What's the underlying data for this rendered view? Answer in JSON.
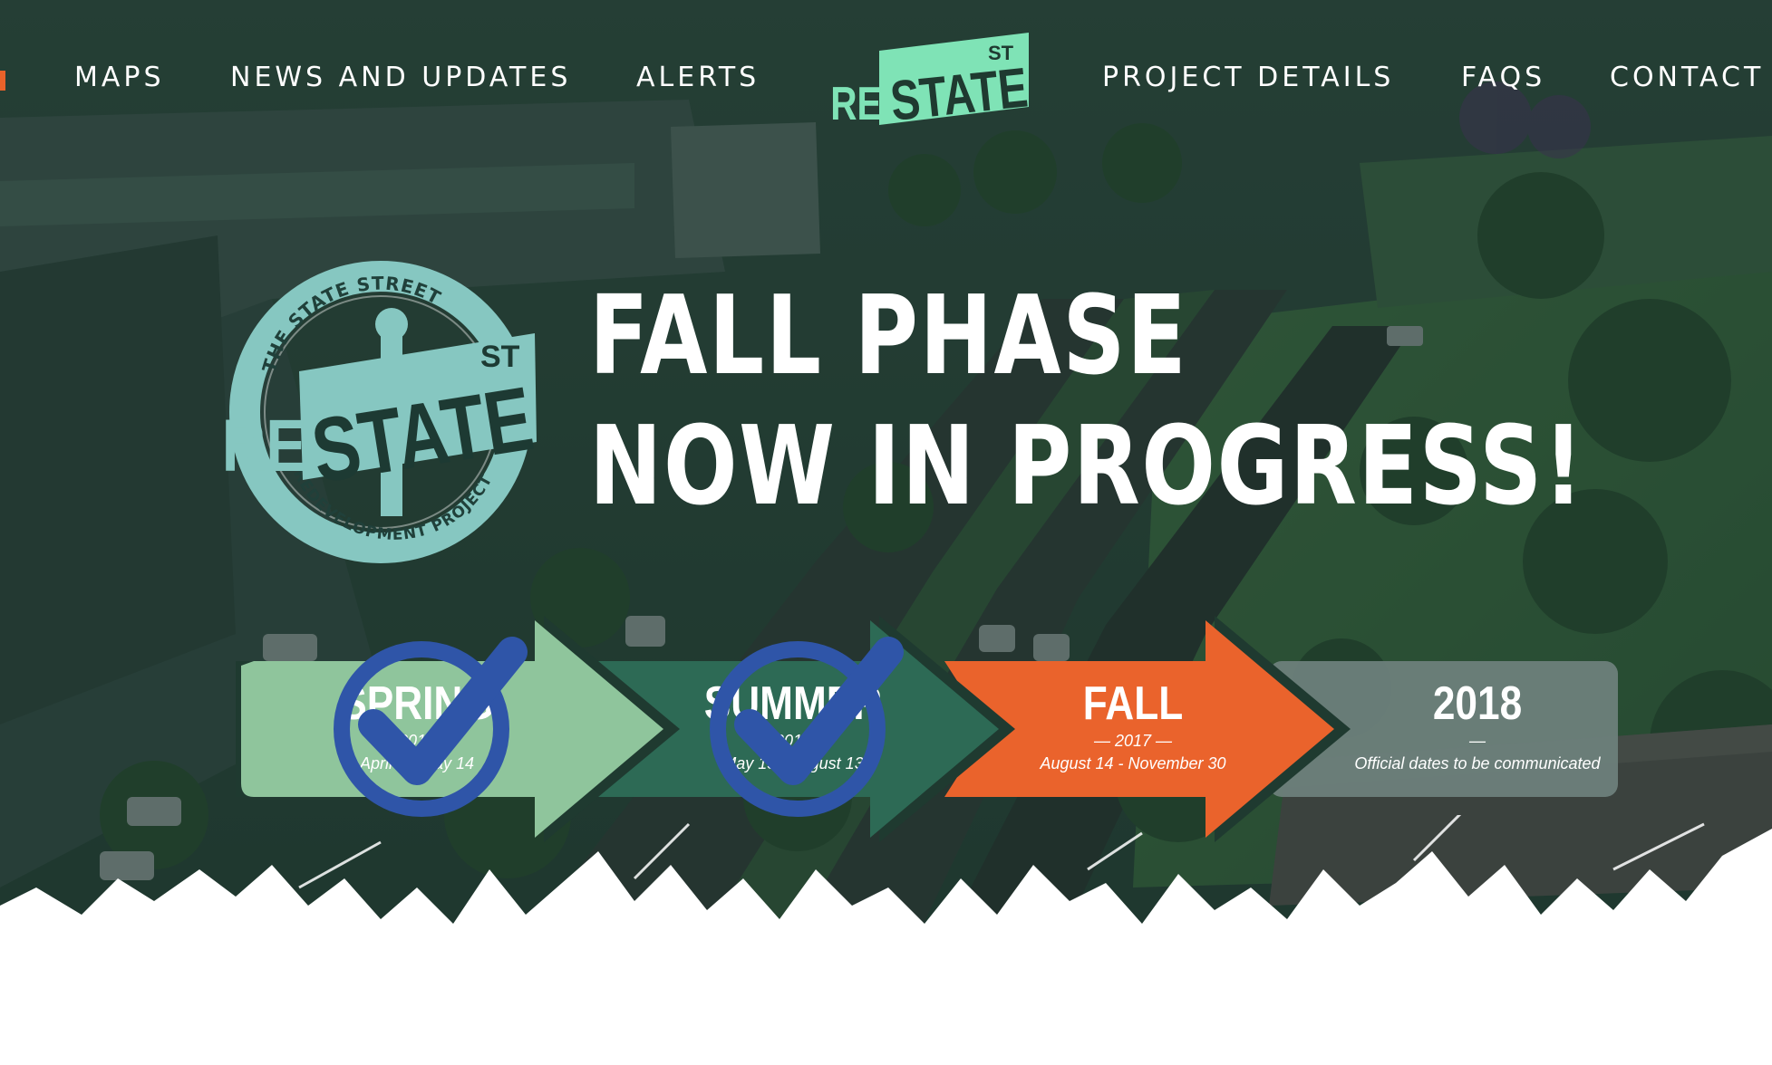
{
  "nav": {
    "items_left": [
      {
        "label": "MAPS"
      },
      {
        "label": "NEWS AND UPDATES"
      },
      {
        "label": "ALERTS"
      }
    ],
    "items_right": [
      {
        "label": "PROJECT DETAILS"
      },
      {
        "label": "FAQS"
      },
      {
        "label": "CONTACT"
      }
    ]
  },
  "logo_header": {
    "re": "RE",
    "state": "STATE",
    "st": "ST"
  },
  "badge": {
    "top_arc": "THE STATE STREET",
    "bottom_arc": "REDEVELOPMENT PROJECT",
    "re": "RE",
    "state": "STATE",
    "st": "ST"
  },
  "headline": {
    "line1": "FALL PHASE",
    "line2": "NOW IN PROGRESS!"
  },
  "timeline": {
    "phases": [
      {
        "name": "SPRING",
        "year": "2017",
        "dates": "April 1 - May 14",
        "status": "complete",
        "color": "#8fc59c"
      },
      {
        "name": "SUMMER",
        "year": "2017",
        "dates": "May 15 - August 13",
        "status": "complete",
        "color": "#2d6a55"
      },
      {
        "name": "FALL",
        "year": "2017",
        "dates": "August 14 - November 30",
        "status": "in-progress",
        "color": "#ea632c"
      },
      {
        "name": "2018",
        "year": "",
        "dates": "Official dates to be communicated",
        "status": "upcoming",
        "color": "#6d7f7b"
      }
    ],
    "check_color": "#2f55a8"
  },
  "colors": {
    "accent_mint": "#7fe3b6",
    "badge_teal": "#86c7c1",
    "overlay": "#14281f",
    "nav_edge": "#e8622a"
  }
}
